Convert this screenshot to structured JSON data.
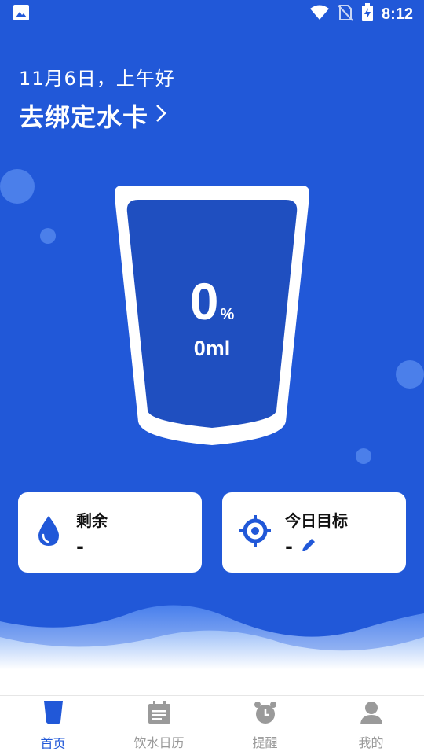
{
  "status_bar": {
    "time": "8:12"
  },
  "header": {
    "greeting": "11月6日，上午好",
    "bind_card_label": "去绑定水卡"
  },
  "cup": {
    "percent_value": "0",
    "percent_sign": "%",
    "volume": "0ml"
  },
  "cards": {
    "remaining": {
      "title": "剩余",
      "value": "-"
    },
    "goal": {
      "title": "今日目标",
      "value": "-"
    }
  },
  "tabbar": {
    "tabs": [
      {
        "label": "首页",
        "icon": "cup-icon",
        "active": true
      },
      {
        "label": "饮水日历",
        "icon": "calendar-icon",
        "active": false
      },
      {
        "label": "提醒",
        "icon": "alarm-icon",
        "active": false
      },
      {
        "label": "我的",
        "icon": "person-icon",
        "active": false
      }
    ]
  },
  "colors": {
    "background": "#2158d8",
    "cup_fill": "#1f4fc0",
    "accent": "#2158d8",
    "tab_inactive": "#9a9a9a"
  }
}
